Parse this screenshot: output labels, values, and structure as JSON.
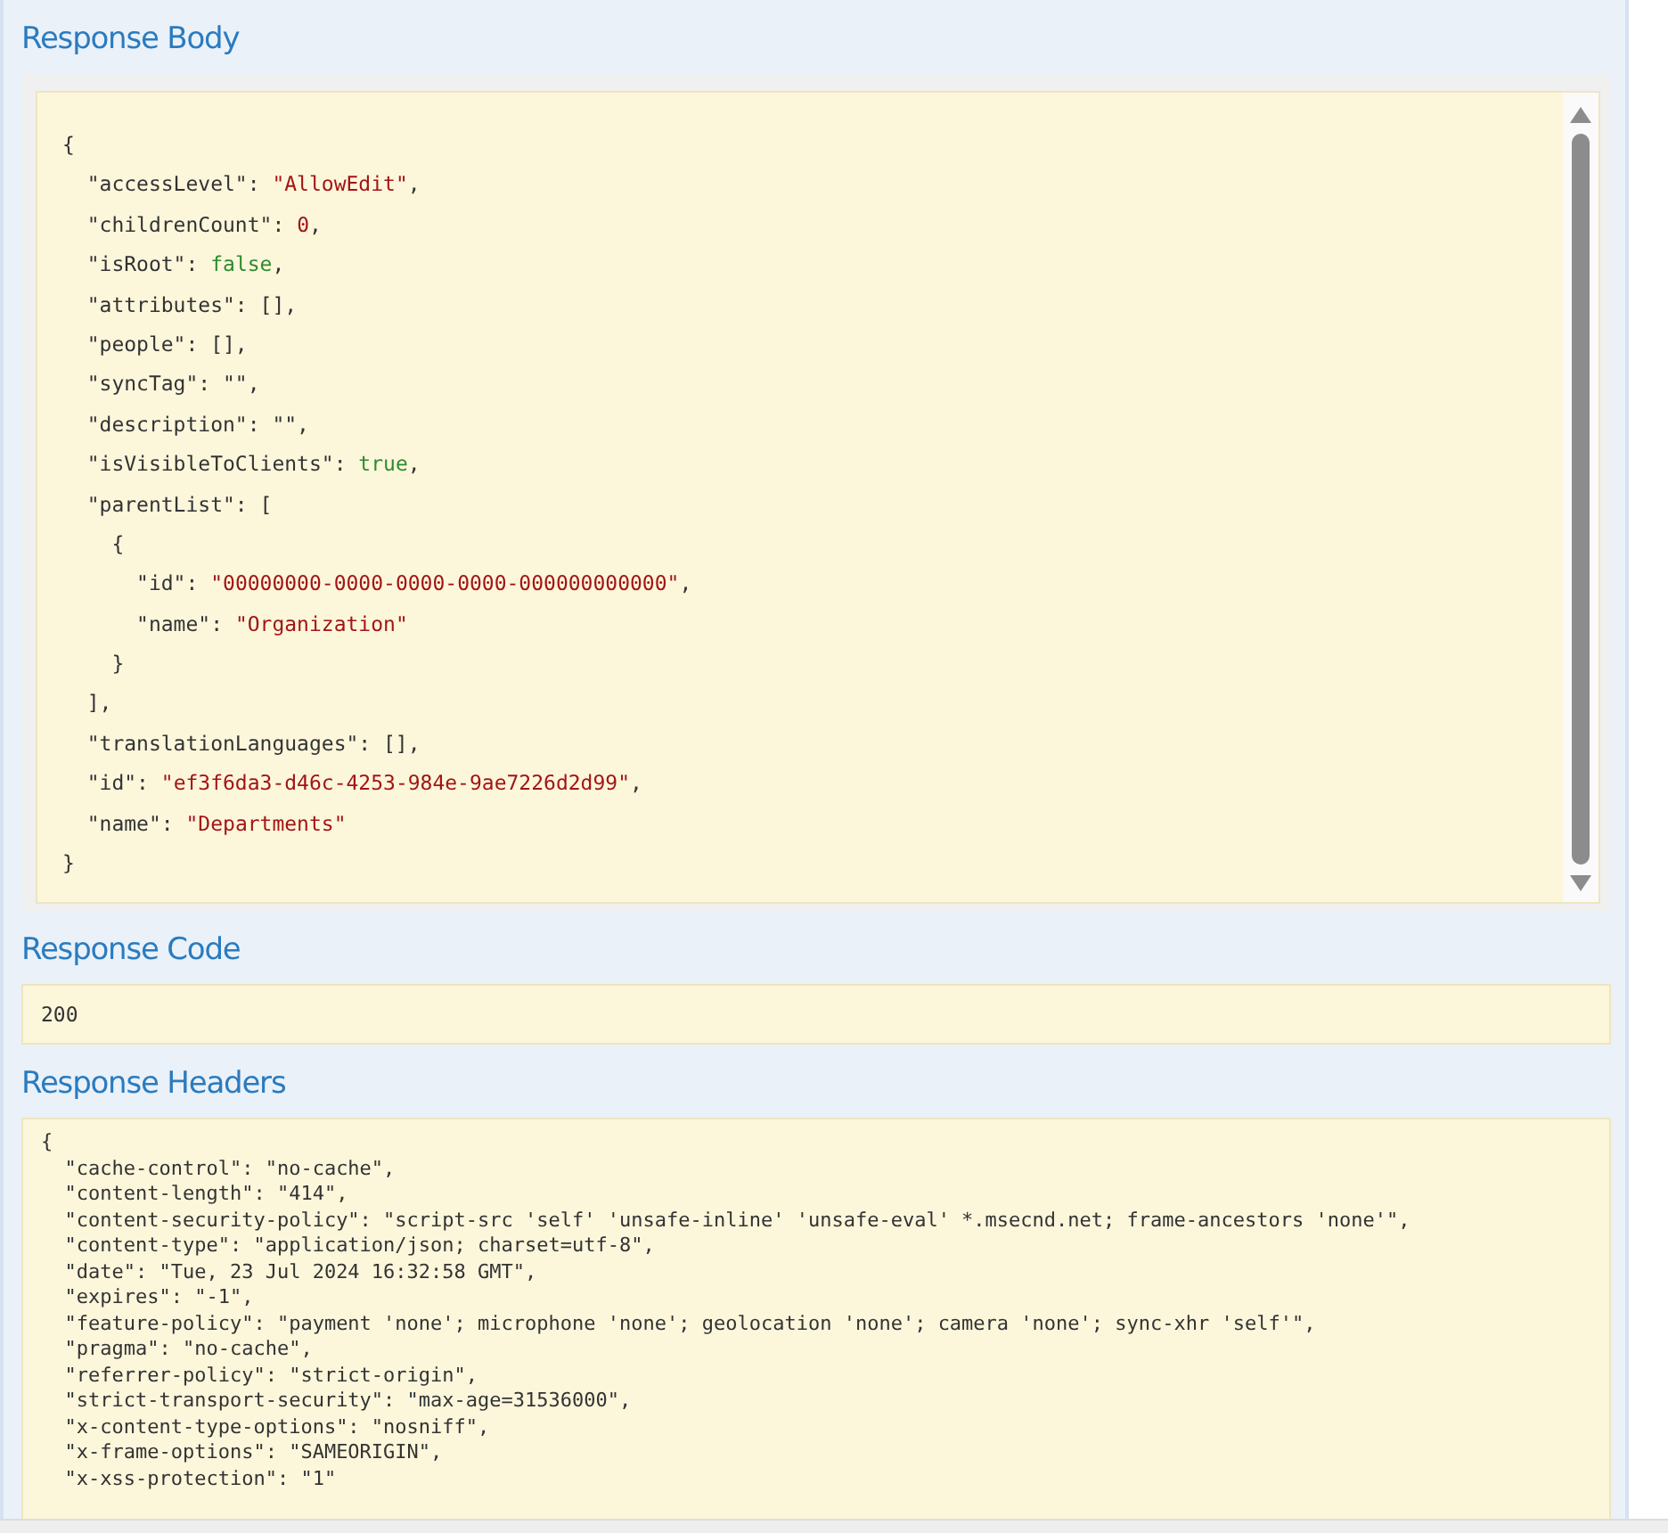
{
  "response_body": {
    "title": "Response Body",
    "lines": [
      {
        "text": "{"
      },
      {
        "text": "  \"accessLevel\": ",
        "value": "\"AllowEdit\"",
        "kind": "string",
        "end": ","
      },
      {
        "text": "  \"childrenCount\": ",
        "value": "0",
        "kind": "number",
        "end": ","
      },
      {
        "text": "  \"isRoot\": ",
        "value": "false",
        "kind": "boolean",
        "end": ","
      },
      {
        "text": "  \"attributes\": [],"
      },
      {
        "text": "  \"people\": [],"
      },
      {
        "text": "  \"syncTag\": \"\","
      },
      {
        "text": "  \"description\": \"\","
      },
      {
        "text": "  \"isVisibleToClients\": ",
        "value": "true",
        "kind": "boolean",
        "end": ","
      },
      {
        "text": "  \"parentList\": ["
      },
      {
        "text": "    {"
      },
      {
        "text": "      \"id\": ",
        "value": "\"00000000-0000-0000-0000-000000000000\"",
        "kind": "string",
        "end": ","
      },
      {
        "text": "      \"name\": ",
        "value": "\"Organization\"",
        "kind": "string"
      },
      {
        "text": "    }"
      },
      {
        "text": "  ],"
      },
      {
        "text": "  \"translationLanguages\": [],"
      },
      {
        "text": "  \"id\": ",
        "value": "\"ef3f6da3-d46c-4253-984e-9ae7226d2d99\"",
        "kind": "string",
        "end": ","
      },
      {
        "text": "  \"name\": ",
        "value": "\"Departments\"",
        "kind": "string"
      },
      {
        "text": "}"
      }
    ]
  },
  "response_code": {
    "title": "Response Code",
    "value": "200"
  },
  "response_headers": {
    "title": "Response Headers",
    "lines": [
      "{",
      "  \"cache-control\": \"no-cache\",",
      "  \"content-length\": \"414\",",
      "  \"content-security-policy\": \"script-src 'self' 'unsafe-inline' 'unsafe-eval' *.msecnd.net; frame-ancestors 'none'\",",
      "  \"content-type\": \"application/json; charset=utf-8\",",
      "  \"date\": \"Tue, 23 Jul 2024 16:32:58 GMT\",",
      "  \"expires\": \"-1\",",
      "  \"feature-policy\": \"payment 'none'; microphone 'none'; geolocation 'none'; camera 'none'; sync-xhr 'self'\",",
      "  \"pragma\": \"no-cache\",",
      "  \"referrer-policy\": \"strict-origin\",",
      "  \"strict-transport-security\": \"max-age=31536000\",",
      "  \"x-content-type-options\": \"nosniff\",",
      "  \"x-frame-options\": \"SAMEORIGIN\",",
      "  \"x-xss-protection\": \"1\""
    ]
  }
}
